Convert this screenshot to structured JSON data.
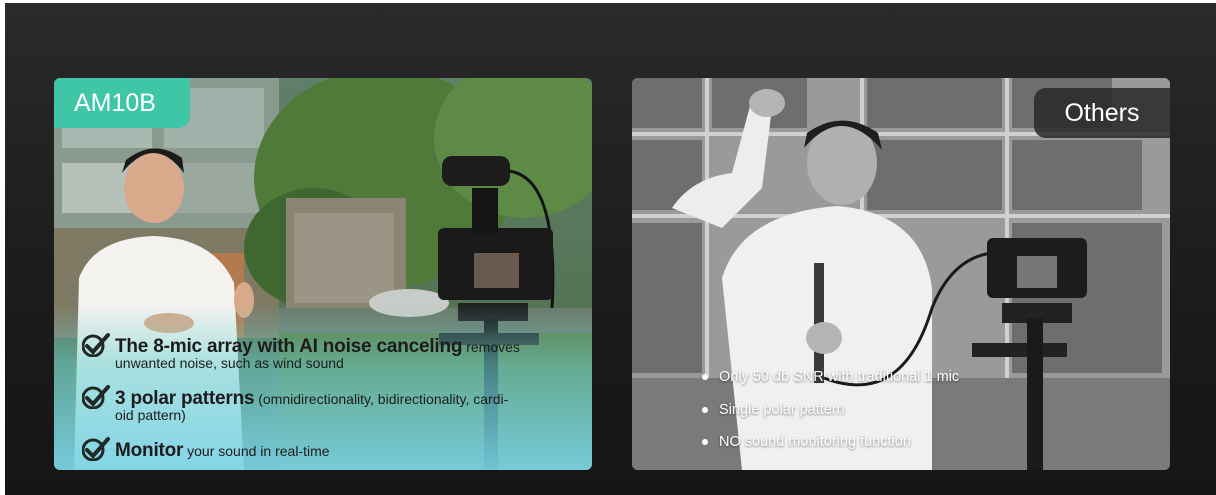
{
  "left_card": {
    "tag": "AM10B",
    "features": [
      {
        "bold": "The 8-mic array with AI noise canceling",
        "rest": " removes",
        "sub": "unwanted noise, such as wind sound"
      },
      {
        "bold": "3 polar patterns",
        "rest": " (omnidirectionality, bidirectionality, cardi-",
        "sub": "oid pattern)"
      },
      {
        "bold": "Monitor",
        "rest": " your sound in real-time",
        "sub": ""
      }
    ]
  },
  "right_card": {
    "tag": "Others",
    "bullets": [
      "Only 50 db SNR with traditional 1 mic",
      "Single polar pattern",
      "NO sound monitoring function"
    ]
  },
  "colors": {
    "accent": "#3fc6a6",
    "check": "#1f2a24",
    "background": "#1e1e1e"
  },
  "icons": [
    "check-icon"
  ]
}
